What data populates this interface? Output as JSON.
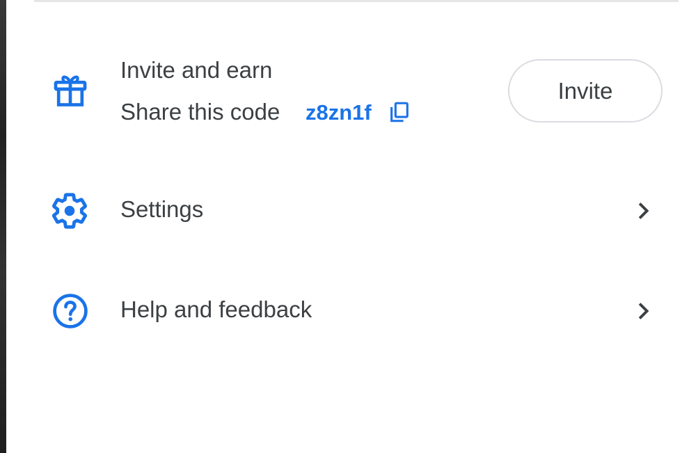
{
  "invite": {
    "title": "Invite and earn",
    "share_label": "Share this code",
    "code": "z8zn1f",
    "button_label": "Invite",
    "icon": "gift-icon"
  },
  "menu": {
    "items": [
      {
        "label": "Settings",
        "icon": "gear-icon"
      },
      {
        "label": "Help and feedback",
        "icon": "help-icon"
      }
    ]
  },
  "colors": {
    "accent": "#1a73e8",
    "text": "#3c4043",
    "border": "#dadce0"
  }
}
